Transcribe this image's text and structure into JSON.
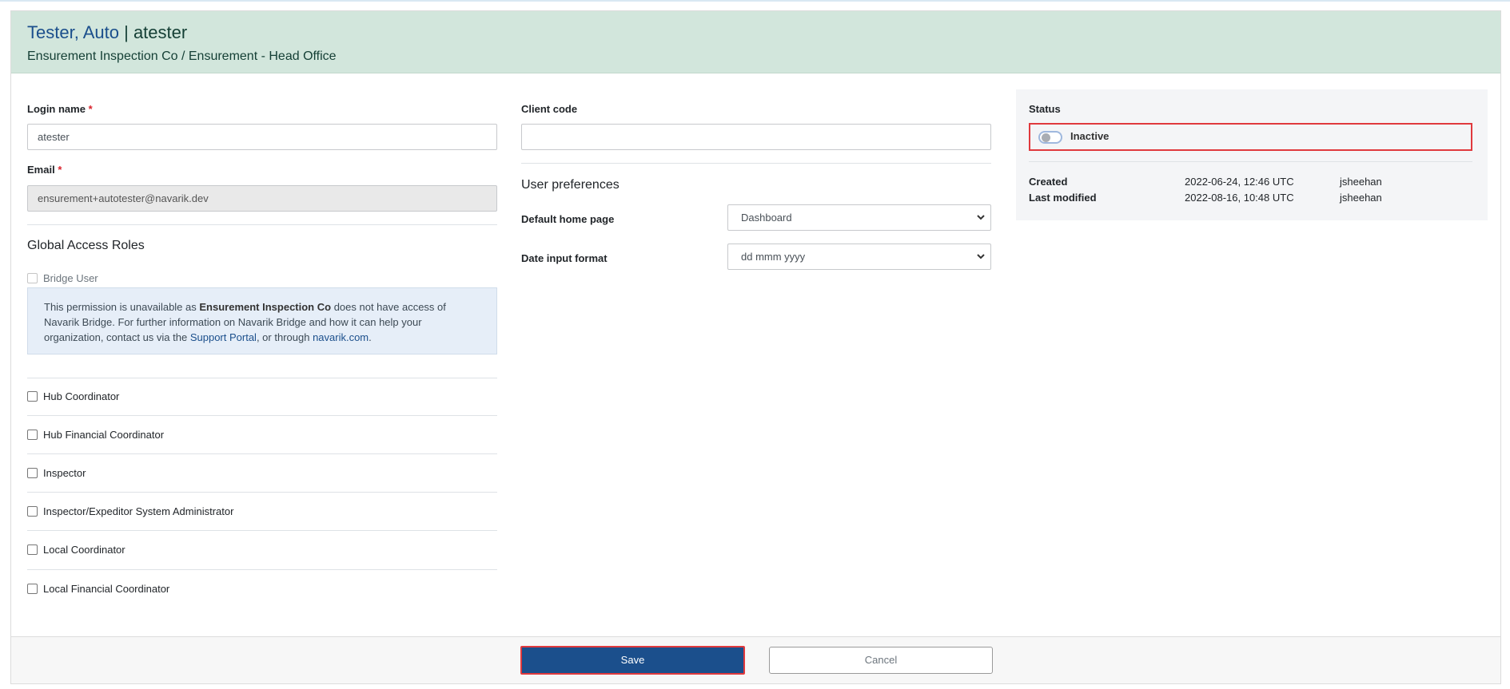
{
  "header": {
    "name": "Tester, Auto",
    "separator": "|",
    "login": "atester",
    "subtitle": "Ensurement Inspection Co / Ensurement - Head Office"
  },
  "left": {
    "login_label": "Login name",
    "login_required": "*",
    "login_value": "atester",
    "email_label": "Email",
    "email_required": "*",
    "email_value": "ensurement+autotester@navarik.dev",
    "roles_title": "Global Access Roles",
    "bridge_label": "Bridge User",
    "info": {
      "p1": "This permission is unavailable as ",
      "company": "Ensurement Inspection Co",
      "p2": " does not have access of Navarik Bridge. For further information on Navarik Bridge and how it can help your organization, contact us via the ",
      "support_link": "Support Portal",
      "p3": ", or through ",
      "site_link": "navarik.com",
      "p4": "."
    },
    "roles": [
      {
        "label": "Hub Coordinator",
        "checked": false
      },
      {
        "label": "Hub Financial Coordinator",
        "checked": false
      },
      {
        "label": "Inspector",
        "checked": false
      },
      {
        "label": "Inspector/Expeditor System Administrator",
        "checked": false
      },
      {
        "label": "Local Coordinator",
        "checked": false
      },
      {
        "label": "Local Financial Coordinator",
        "checked": false
      }
    ]
  },
  "middle": {
    "client_code_label": "Client code",
    "client_code_value": "",
    "prefs_title": "User preferences",
    "home_label": "Default home page",
    "home_value": "Dashboard",
    "date_label": "Date input format",
    "date_value": "dd mmm yyyy"
  },
  "status": {
    "label": "Status",
    "toggle_on": false,
    "value": "Inactive",
    "created_label": "Created",
    "created_date": "2022-06-24, 12:46 UTC",
    "created_by": "jsheehan",
    "modified_label": "Last modified",
    "modified_date": "2022-08-16, 10:48 UTC",
    "modified_by": "jsheehan"
  },
  "footer": {
    "save_label": "Save",
    "cancel_label": "Cancel"
  },
  "colors": {
    "header_bg": "#d2e6dc",
    "primary": "#1b4f8c",
    "highlight": "#e0393d"
  }
}
